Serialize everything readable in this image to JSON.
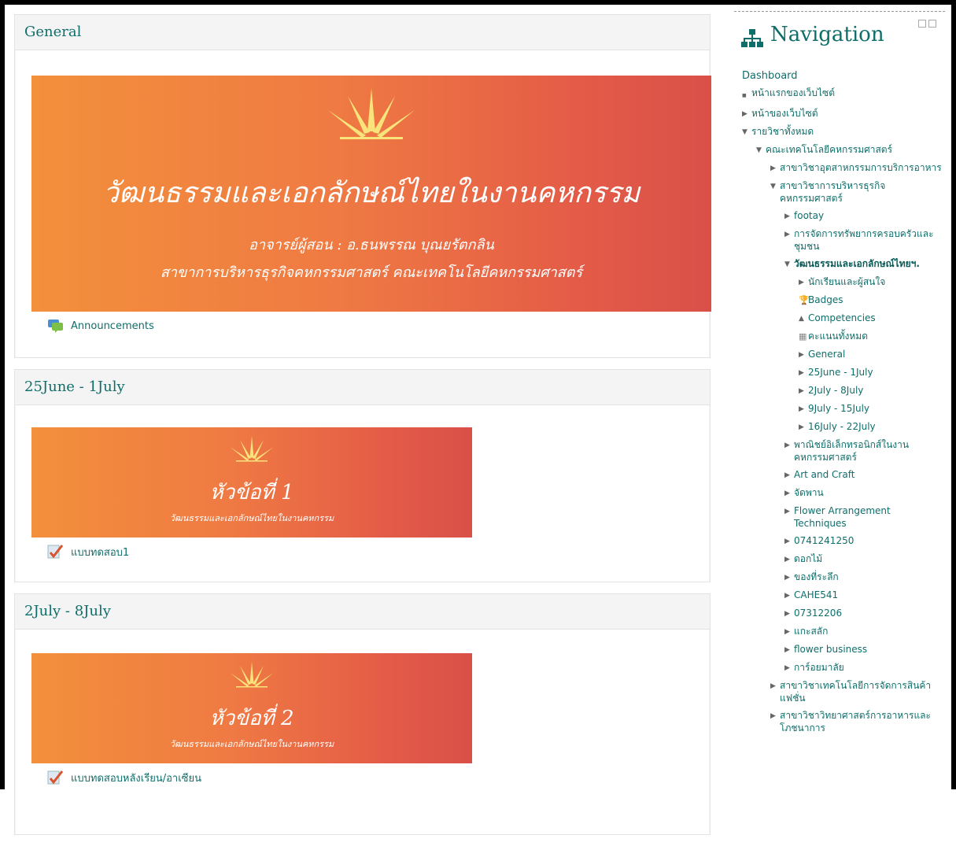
{
  "sections": [
    {
      "title": "General",
      "banner": {
        "title": "วัฒนธรรมและเอกลักษณ์ไทยในงานคหกรรม",
        "line1": "อาจารย์ผู้สอน : อ.ธนพรรณ บุณยรัตกลิน",
        "line2": "สาขาการบริหารธุรกิจคหกรรมศาสตร์  คณะเทคโนโลยีคหกรรมศาสตร์"
      },
      "activity": "Announcements"
    },
    {
      "title": "25June - 1July",
      "banner": {
        "title": "หัวข้อที่ 1",
        "sub": "วัฒนธรรมและเอกลักษณ์ไทยในงานคหกรรม"
      },
      "activity": "แบบทดสอบ1"
    },
    {
      "title": "2July - 8July",
      "banner": {
        "title": "หัวข้อที่ 2",
        "sub": "วัฒนธรรมและเอกลักษณ์ไทยในงานคหกรรม"
      },
      "activity": "แบบทดสอบหลังเรียน/อาเซียน"
    }
  ],
  "nav": {
    "title": "Navigation",
    "dashboard": "Dashboard",
    "items": [
      {
        "label": "หน้าแรกของเว็บไซต์",
        "indent": 0,
        "toggle": "bullet"
      },
      {
        "label": "หน้าของเว็บไซต์",
        "indent": 0,
        "toggle": "closed"
      },
      {
        "label": "รายวิชาทั้งหมด",
        "indent": 0,
        "toggle": "open"
      },
      {
        "label": "คณะเทคโนโลยีคหกรรมศาสตร์",
        "indent": 1,
        "toggle": "open"
      },
      {
        "label": "สาขาวิชาอุตสาหกรรมการบริการอาหาร",
        "indent": 2,
        "toggle": "closed"
      },
      {
        "label": "สาขาวิชาการบริหารธุรกิจคหกรรมศาสตร์",
        "indent": 2,
        "toggle": "open"
      },
      {
        "label": "footay",
        "indent": 3,
        "toggle": "closed"
      },
      {
        "label": "การจัดการทรัพยากรครอบครัวและชุมชน",
        "indent": 3,
        "toggle": "closed"
      },
      {
        "label": "วัฒนธรรมและเอกลักษณ์ไทยฯ.",
        "indent": 3,
        "toggle": "open",
        "bold": true
      },
      {
        "label": "นักเรียนและผู้สนใจ",
        "indent": 4,
        "toggle": "closed"
      },
      {
        "label": "Badges",
        "indent": 4,
        "toggle": "trophy"
      },
      {
        "label": "Competencies",
        "indent": 4,
        "toggle": "triangle"
      },
      {
        "label": "คะแนนทั้งหมด",
        "indent": 4,
        "toggle": "grid"
      },
      {
        "label": "General",
        "indent": 4,
        "toggle": "closed"
      },
      {
        "label": "25June - 1July",
        "indent": 4,
        "toggle": "closed"
      },
      {
        "label": "2July - 8July",
        "indent": 4,
        "toggle": "closed"
      },
      {
        "label": "9July - 15July",
        "indent": 4,
        "toggle": "closed"
      },
      {
        "label": "16July - 22July",
        "indent": 4,
        "toggle": "closed"
      },
      {
        "label": "พาณิชย์อิเล็กทรอนิกส์ในงานคหกรรมศาสตร์",
        "indent": 3,
        "toggle": "closed"
      },
      {
        "label": "Art and Craft",
        "indent": 3,
        "toggle": "closed"
      },
      {
        "label": "จัดพาน",
        "indent": 3,
        "toggle": "closed"
      },
      {
        "label": "Flower Arrangement Techniques",
        "indent": 3,
        "toggle": "closed"
      },
      {
        "label": "0741241250",
        "indent": 3,
        "toggle": "closed"
      },
      {
        "label": "ดอกไม้",
        "indent": 3,
        "toggle": "closed"
      },
      {
        "label": "ของที่ระลึก",
        "indent": 3,
        "toggle": "closed"
      },
      {
        "label": "CAHE541",
        "indent": 3,
        "toggle": "closed"
      },
      {
        "label": "07312206",
        "indent": 3,
        "toggle": "closed"
      },
      {
        "label": "แกะสลัก",
        "indent": 3,
        "toggle": "closed"
      },
      {
        "label": "flower business",
        "indent": 3,
        "toggle": "closed"
      },
      {
        "label": "การ์อยมาลัย",
        "indent": 3,
        "toggle": "closed"
      },
      {
        "label": "สาขาวิชาเทคโนโลยีการจัดการสินค้าแฟชั่น",
        "indent": 2,
        "toggle": "closed"
      },
      {
        "label": "สาขาวิชาวิทยาศาสตร์การอาหารและโภชนาการ",
        "indent": 2,
        "toggle": "closed"
      }
    ]
  }
}
